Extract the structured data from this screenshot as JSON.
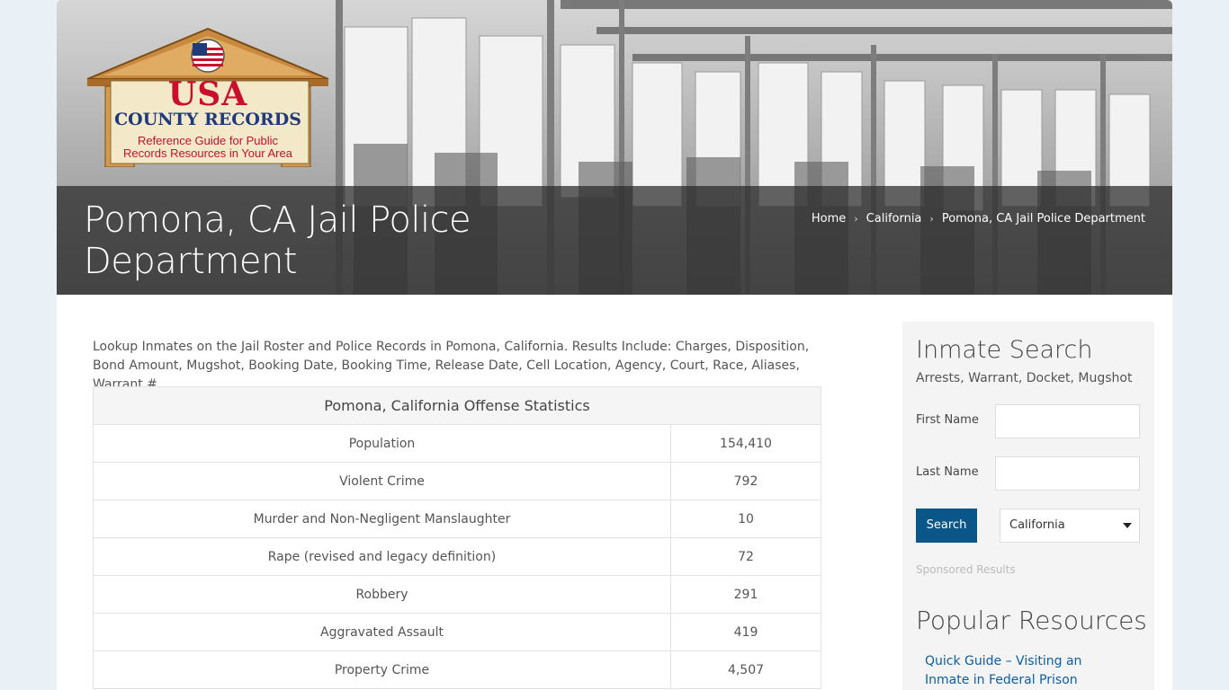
{
  "header": {
    "logo": {
      "line1": "USA",
      "line2": "COUNTY RECORDS",
      "tagline1": "Reference Guide for Public",
      "tagline2": "Records Resources in Your Area"
    },
    "page_title": "Pomona, CA Jail Police Department",
    "breadcrumb": [
      "Home",
      "California",
      "Pomona, CA Jail Police Department"
    ]
  },
  "main": {
    "intro": "Lookup Inmates on the Jail Roster and Police Records in Pomona, California. Results Include: Charges, Disposition, Bond Amount, Mugshot, Booking Date, Booking Time, Release Date, Cell Location, Agency, Court, Race, Aliases, Warrant #",
    "table": {
      "title": "Pomona, California Offense Statistics",
      "rows": [
        {
          "label": "Population",
          "value": "154,410"
        },
        {
          "label": "Violent Crime",
          "value": "792"
        },
        {
          "label": "Murder and Non-Negligent Manslaughter",
          "value": "10"
        },
        {
          "label": "Rape (revised and legacy definition)",
          "value": "72"
        },
        {
          "label": "Robbery",
          "value": "291"
        },
        {
          "label": "Aggravated Assault",
          "value": "419"
        },
        {
          "label": "Property Crime",
          "value": "4,507"
        }
      ]
    }
  },
  "sidebar": {
    "title": "Inmate Search",
    "subtitle": "Arrests, Warrant, Docket, Mugshot",
    "first_name_label": "First Name",
    "last_name_label": "Last Name",
    "search_label": "Search",
    "state_selected": "California",
    "sponsored": "Sponsored Results",
    "popular_title": "Popular Resources",
    "popular_link": "Quick Guide – Visiting an Inmate in Federal Prison"
  },
  "colors": {
    "accent": "#0b5688",
    "link": "#0b5fa5",
    "logo_red": "#c8102e",
    "logo_blue": "#1f3b7a"
  }
}
